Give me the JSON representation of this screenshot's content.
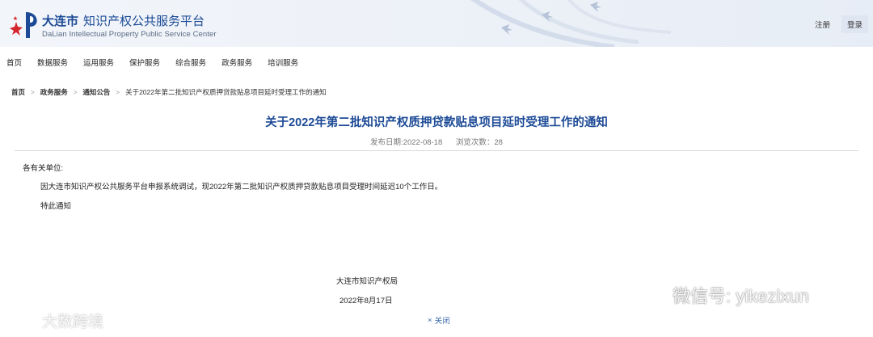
{
  "header": {
    "site_city": "大连市",
    "site_name": "知识产权公共服务平台",
    "site_name_en": "DaLian Intellectual Property Public Service Center",
    "register_label": "注册",
    "login_label": "登录",
    "brand_color": "#1c4a96"
  },
  "nav": {
    "items": [
      {
        "label": "首页"
      },
      {
        "label": "数据服务"
      },
      {
        "label": "运用服务"
      },
      {
        "label": "保护服务"
      },
      {
        "label": "综合服务"
      },
      {
        "label": "政务服务"
      },
      {
        "label": "培训服务"
      }
    ]
  },
  "breadcrumb": {
    "items": [
      "首页",
      "政务服务",
      "通知公告"
    ],
    "current": "关于2022年第二批知识产权质押贷款贴息项目延时受理工作的通知"
  },
  "article": {
    "title": "关于2022年第二批知识产权质押贷款贴息项目延时受理工作的通知",
    "publish_date": "发布日期:2022-08-18",
    "views": "浏览次数：28",
    "salutation": "各有关单位:",
    "paragraphs": [
      "因大连市知识产权公共服务平台申报系统调试，现2022年第二批知识产权质押贷款贴息项目受理时间延迟10个工作日。",
      "特此通知"
    ],
    "signer": "大连市知识产权局",
    "sign_date": "2022年8月17日",
    "close_label": "关闭"
  },
  "watermarks": {
    "left_text": "大数跨境",
    "right_text": "微信号: yikezixun"
  }
}
